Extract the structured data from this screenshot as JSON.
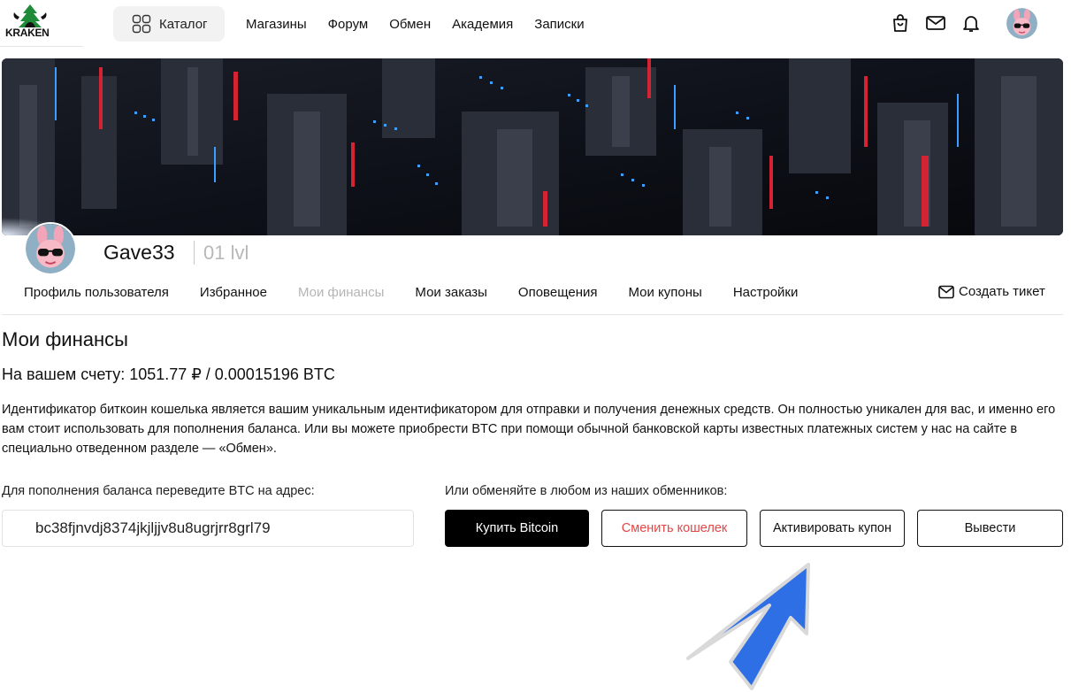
{
  "brand": {
    "name": "KRAKEN"
  },
  "header": {
    "catalog_label": "Каталог",
    "nav": [
      {
        "label": "Магазины"
      },
      {
        "label": "Форум"
      },
      {
        "label": "Обмен"
      },
      {
        "label": "Академия"
      },
      {
        "label": "Записки"
      }
    ],
    "icons": [
      "shopping-bag-icon",
      "mail-icon",
      "bell-icon"
    ]
  },
  "profile": {
    "username": "Gave33",
    "level": "01 lvl"
  },
  "tabs": [
    {
      "label": "Профиль пользователя",
      "active": false
    },
    {
      "label": "Избранное",
      "active": false
    },
    {
      "label": "Мои финансы",
      "active": true
    },
    {
      "label": "Мои заказы",
      "active": false
    },
    {
      "label": "Оповещения",
      "active": false
    },
    {
      "label": "Мои купоны",
      "active": false
    },
    {
      "label": "Настройки",
      "active": false
    }
  ],
  "ticket_label": "Создать тикет",
  "finances": {
    "title": "Мои финансы",
    "balance_label": "На вашем счету: ",
    "balance_value": "1051.77 ₽ / 0.00015196 BTC",
    "description": "Идентификатор биткоин кошелька является вашим уникальным идентификатором для отправки и получения денежных средств. Он полностью уникален для вас, и именно его вам стоит использовать для пополнения баланса. Или вы можете приобрести BTC при помощи обычной банковской карты известных платежных систем у нас на сайте в специально отведенном разделе — «Обмен».",
    "address_label": "Для пополнения баланса переведите BTC на адрес:",
    "address": "bc38fjnvdj8374jkjljjv8u8ugrjrr8grl79",
    "exchange_label": "Или обменяйте в любом из наших обменников:",
    "buttons": {
      "buy": "Купить Bitcoin",
      "change_wallet": "Сменить кошелек",
      "activate_coupon": "Активировать купон",
      "withdraw": "Вывести"
    }
  },
  "colors": {
    "accent_red": "#e64545",
    "primary_button": "#000000",
    "arrow_blue": "#2f6fe6",
    "muted_text": "#b5b5b5"
  }
}
